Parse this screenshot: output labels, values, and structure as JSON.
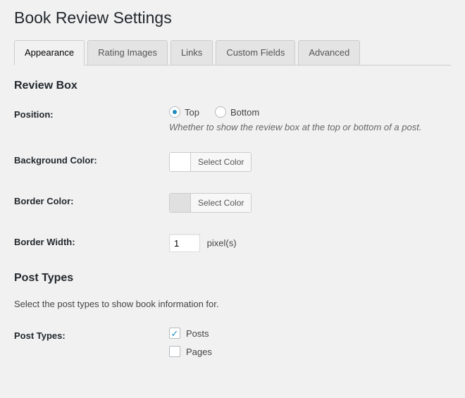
{
  "page_title": "Book Review Settings",
  "tabs": [
    {
      "label": "Appearance",
      "active": true
    },
    {
      "label": "Rating Images",
      "active": false
    },
    {
      "label": "Links",
      "active": false
    },
    {
      "label": "Custom Fields",
      "active": false
    },
    {
      "label": "Advanced",
      "active": false
    }
  ],
  "sections": {
    "review_box": {
      "heading": "Review Box",
      "position": {
        "label": "Position:",
        "options": [
          "Top",
          "Bottom"
        ],
        "selected": "Top",
        "description": "Whether to show the review box at the top or bottom of a post."
      },
      "background_color": {
        "label": "Background Color:",
        "button": "Select Color",
        "swatch": "#ffffff"
      },
      "border_color": {
        "label": "Border Color:",
        "button": "Select Color",
        "swatch": "#e0e0e0"
      },
      "border_width": {
        "label": "Border Width:",
        "value": "1",
        "unit": "pixel(s)"
      }
    },
    "post_types": {
      "heading": "Post Types",
      "description": "Select the post types to show book information for.",
      "label": "Post Types:",
      "options": [
        {
          "label": "Posts",
          "checked": true
        },
        {
          "label": "Pages",
          "checked": false
        }
      ]
    }
  }
}
